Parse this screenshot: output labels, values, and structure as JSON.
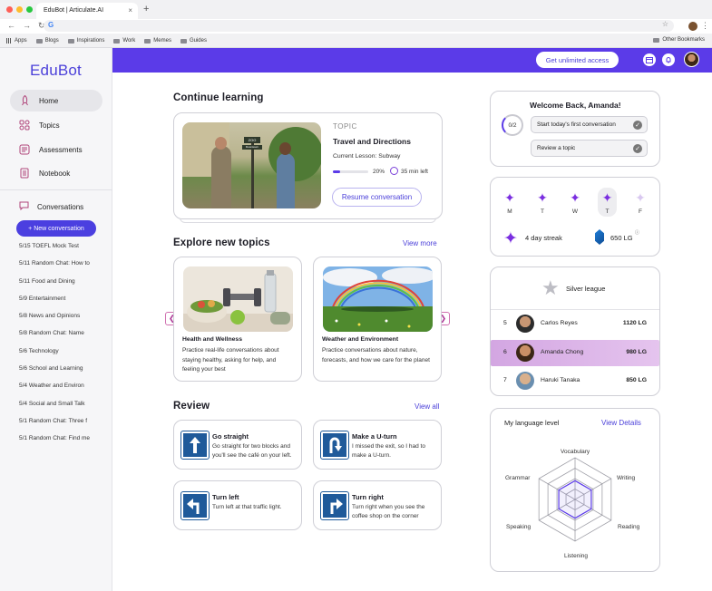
{
  "browser": {
    "tab_title": "EduBot | Articulate.AI",
    "tab_close": "×",
    "new_tab": "+",
    "url_glyph": "G",
    "bookmarks": [
      "Apps",
      "Blogs",
      "Inspirations",
      "Work",
      "Memes",
      "Guides"
    ],
    "other_bookmarks": "Other Bookmarks"
  },
  "sidebar": {
    "logo": "EduBot",
    "nav": [
      {
        "label": "Home",
        "icon": "rocket-icon"
      },
      {
        "label": "Topics",
        "icon": "topics-icon"
      },
      {
        "label": "Assessments",
        "icon": "assessment-icon"
      },
      {
        "label": "Notebook",
        "icon": "notebook-icon"
      }
    ],
    "conversations_label": "Conversations",
    "new_conversation": "+ New conversation",
    "conversations": [
      "5/15 TOEFL Mock Test",
      "5/11 Random Chat: How to",
      "5/11 Food and Dining",
      "5/9 Entertainment",
      "5/8 News and Opinions",
      "5/8 Random Chat: Name",
      "5/6 Technology",
      "5/6 School and Learning",
      "5/4 Weather and Environ",
      "5/4 Social and Small Talk",
      "5/1 Random Chat: Three f",
      "5/1 Random Chat: Find me"
    ]
  },
  "topbar": {
    "unlimited": "Get unlimited access"
  },
  "continue": {
    "heading": "Continue learning",
    "topic_label": "TOPIC",
    "title": "Travel and Directions",
    "lesson": "Current Lesson: Subway",
    "progress_pct": "20%",
    "progress_value": 0.2,
    "time_left": "35 min left",
    "resume": "Resume conversation",
    "sign_top": "ZOO",
    "sign_bottom": "Downtown"
  },
  "explore": {
    "heading": "Explore new topics",
    "view_more": "View more",
    "prev_glyph": "❮",
    "next_glyph": "❯",
    "cards": [
      {
        "title": "Health and Wellness",
        "desc": "Practice real-life conversations about staying healthy, asking for help, and feeling your best"
      },
      {
        "title": "Weather and Environment",
        "desc": "Practice conversations about nature, forecasts, and how we care for the planet"
      }
    ]
  },
  "review": {
    "heading": "Review",
    "view_all": "View all",
    "cards": [
      {
        "title": "Go straight",
        "desc": "Go straight for two blocks and you'll see the café on your left.",
        "icon": "arrow-up-sign-icon",
        "glyph": "↑"
      },
      {
        "title": "Make a U-turn",
        "desc": "I missed the exit, so I had to make a U-turn.",
        "icon": "u-turn-sign-icon",
        "glyph": "⮌"
      },
      {
        "title": "Turn left",
        "desc": "Turn left at that traffic light.",
        "icon": "turn-left-sign-icon",
        "glyph": "↰"
      },
      {
        "title": "Turn right",
        "desc": "Turn right when you see the coffee shop on the corner",
        "icon": "turn-right-sign-icon",
        "glyph": "↱"
      }
    ]
  },
  "welcome": {
    "title": "Welcome Back, Amanda!",
    "progress": "0/2",
    "tasks": [
      "Start today's first conversation",
      "Review a topic"
    ],
    "check_glyph": "✓"
  },
  "streak": {
    "days": [
      "M",
      "T",
      "W",
      "T",
      "F"
    ],
    "star_glyph": "✦",
    "streak_text": "4 day streak",
    "lg_points": "650 LG",
    "info_glyph": "ⓘ"
  },
  "league": {
    "title": "Silver league",
    "badge_glyph": "★",
    "rows": [
      {
        "rank": "5",
        "name": "Carlos Reyes",
        "score": "1120 LG"
      },
      {
        "rank": "6",
        "name": "Amanda Chong",
        "score": "980 LG"
      },
      {
        "rank": "7",
        "name": "Haruki Tanaka",
        "score": "850 LG"
      }
    ]
  },
  "level": {
    "title": "My language level",
    "view_details": "View Details",
    "skills": [
      "Vocabulary",
      "Writing",
      "Reading",
      "Listening",
      "Speaking",
      "Grammar"
    ],
    "scores": [
      0.45,
      0.45,
      0.45,
      0.45,
      0.45,
      0.45
    ]
  },
  "colors": {
    "accent": "#5b3be8",
    "brand_text": "#4a3fd9",
    "star": "#7a2ee0"
  }
}
